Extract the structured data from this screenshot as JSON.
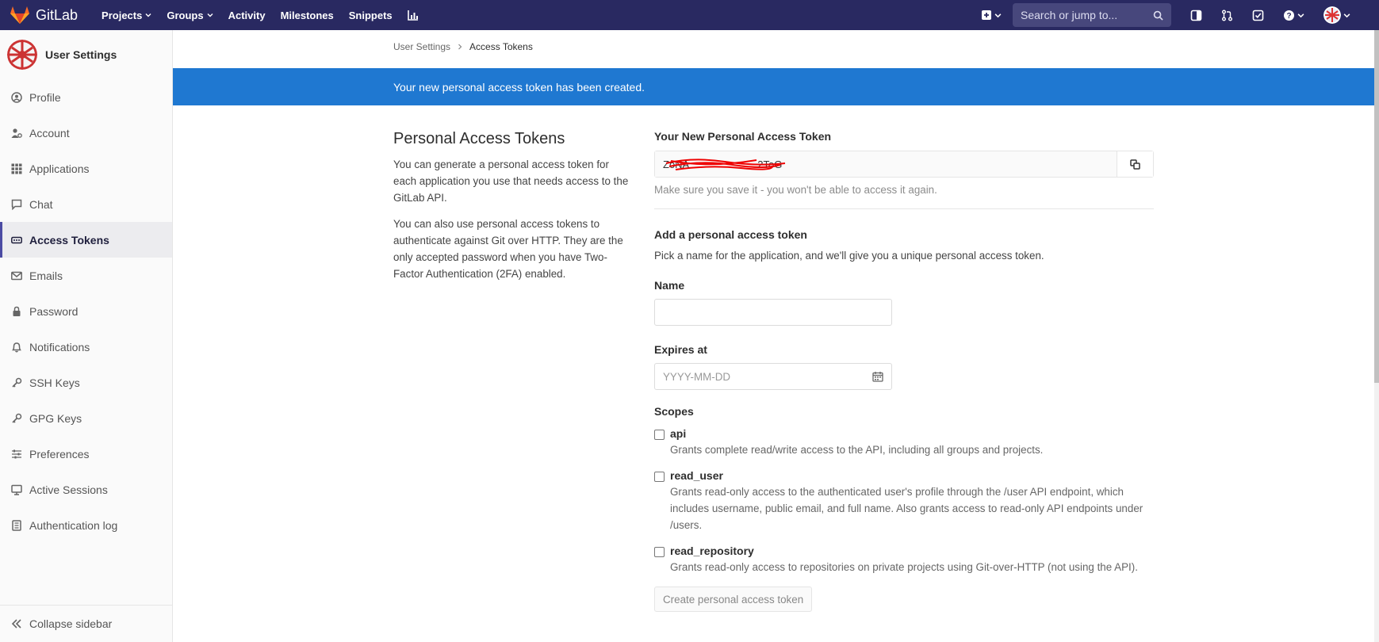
{
  "navbar": {
    "brand": "GitLab",
    "links": [
      {
        "label": "Projects",
        "has_caret": true
      },
      {
        "label": "Groups",
        "has_caret": true
      },
      {
        "label": "Activity",
        "has_caret": false
      },
      {
        "label": "Milestones",
        "has_caret": false
      },
      {
        "label": "Snippets",
        "has_caret": false
      }
    ],
    "search_placeholder": "Search or jump to...",
    "bg_color": "#292961"
  },
  "sidebar": {
    "title": "User Settings",
    "items": [
      {
        "label": "Profile",
        "icon": "profile-icon",
        "active": false
      },
      {
        "label": "Account",
        "icon": "account-icon",
        "active": false
      },
      {
        "label": "Applications",
        "icon": "applications-icon",
        "active": false
      },
      {
        "label": "Chat",
        "icon": "chat-icon",
        "active": false
      },
      {
        "label": "Access Tokens",
        "icon": "token-icon",
        "active": true
      },
      {
        "label": "Emails",
        "icon": "email-icon",
        "active": false
      },
      {
        "label": "Password",
        "icon": "lock-icon",
        "active": false
      },
      {
        "label": "Notifications",
        "icon": "bell-icon",
        "active": false
      },
      {
        "label": "SSH Keys",
        "icon": "key-icon",
        "active": false
      },
      {
        "label": "GPG Keys",
        "icon": "key-icon",
        "active": false
      },
      {
        "label": "Preferences",
        "icon": "sliders-icon",
        "active": false
      },
      {
        "label": "Active Sessions",
        "icon": "monitor-icon",
        "active": false
      },
      {
        "label": "Authentication log",
        "icon": "log-icon",
        "active": false
      }
    ],
    "collapse_label": "Collapse sidebar"
  },
  "breadcrumb": {
    "parent": "User Settings",
    "current": "Access Tokens"
  },
  "flash": {
    "message": "Your new personal access token has been created.",
    "color": "#1f78d1"
  },
  "intro": {
    "title": "Personal Access Tokens",
    "paragraph1": "You can generate a personal access token for each application you use that needs access to the GitLab API.",
    "paragraph2": "You can also use personal access tokens to authenticate against Git over HTTP. They are the only accepted password when you have Two-Factor Authentication (2FA) enabled."
  },
  "new_token": {
    "label": "Your New Personal Access Token",
    "value": "ZoNA",
    "value_tail": "2ToG",
    "help": "Make sure you save it - you won't be able to access it again."
  },
  "form": {
    "heading": "Add a personal access token",
    "description": "Pick a name for the application, and we'll give you a unique personal access token.",
    "name_label": "Name",
    "name_value": "",
    "expires_label": "Expires at",
    "expires_placeholder": "YYYY-MM-DD",
    "scopes_label": "Scopes",
    "scopes": [
      {
        "name": "api",
        "description": "Grants complete read/write access to the API, including all groups and projects."
      },
      {
        "name": "read_user",
        "description": "Grants read-only access to the authenticated user's profile through the /user API endpoint, which includes username, public email, and full name. Also grants access to read-only API endpoints under /users."
      },
      {
        "name": "read_repository",
        "description": "Grants read-only access to repositories on private projects using Git-over-HTTP (not using the API)."
      }
    ],
    "submit_label": "Create personal access token"
  }
}
